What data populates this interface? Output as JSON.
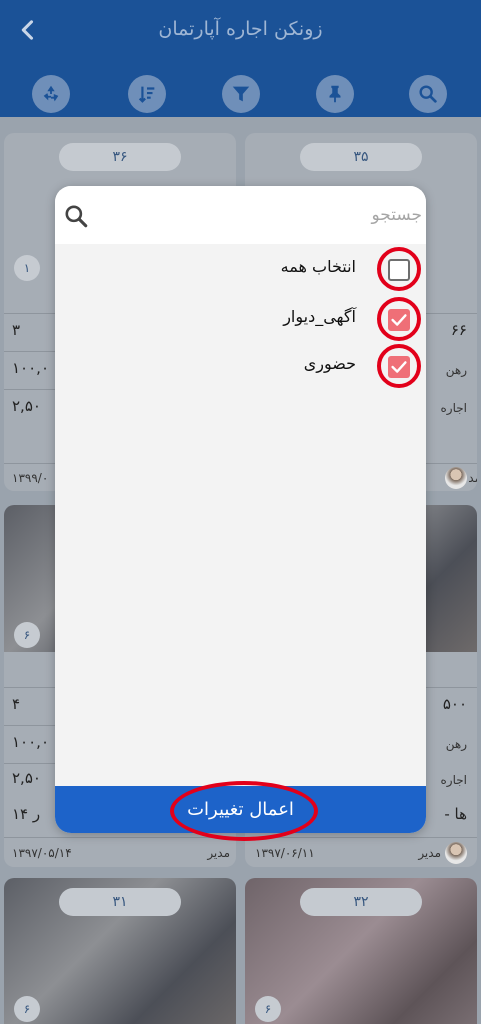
{
  "header": {
    "title": "زونکن اجاره آپارتمان",
    "back_icon": "chevron-left-icon",
    "toolbar": [
      {
        "name": "recycle-icon"
      },
      {
        "name": "sort-icon"
      },
      {
        "name": "filter-icon"
      },
      {
        "name": "pin-icon"
      },
      {
        "name": "search-icon"
      }
    ]
  },
  "listing": {
    "cards": [
      {
        "number": "۳۶",
        "photo_count": "۱",
        "rooms": "۳",
        "deposit": "۱۰۰,۰",
        "rent": "۲,۵۰",
        "date": "۱۳۹۹/۰"
      },
      {
        "number": "۳۵",
        "rooms": "۶۶",
        "deposit_label": "رهن",
        "rent_label": "اجاره",
        "agent": "مد"
      },
      {
        "photo_count": "۶",
        "rooms": "۴",
        "deposit": "۱۰۰,۰",
        "rent": "۲,۵۰",
        "floor": "ر ۱۴",
        "date": "۱۳۹۷/۰۵/۱۴",
        "agent": "مدیر"
      },
      {
        "area": "۵۰۰",
        "deposit_label": "رهن",
        "rent_label": "اجاره",
        "extra": "- ها",
        "date": "۱۳۹۷/۰۶/۱۱",
        "agent": "مدیر"
      },
      {
        "number": "۳۱",
        "photo_count": "۶"
      },
      {
        "number": "۳۲",
        "photo_count": "۶"
      }
    ]
  },
  "dialog": {
    "search": {
      "placeholder": "جستجو",
      "value": ""
    },
    "options": [
      {
        "label": "انتخاب همه",
        "checked": false
      },
      {
        "label": "آگهی_دیوار",
        "checked": true
      },
      {
        "label": "حضوری",
        "checked": true
      }
    ],
    "apply_label": "اعمال تغییرات"
  },
  "colors": {
    "appbar": "#1b5297",
    "apply_button": "#1d63c9",
    "checkbox_checked": "#ef6f77",
    "highlight_ring": "#e2001a"
  }
}
